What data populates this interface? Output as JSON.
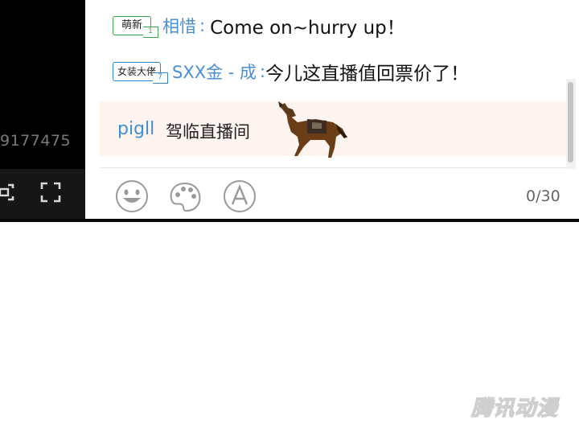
{
  "stream_player": {
    "viewer_count": "9177475",
    "controls": [
      {
        "icon": "picture-in-picture-icon"
      },
      {
        "icon": "fullscreen-icon"
      }
    ]
  },
  "chat": {
    "messages": [
      {
        "badge": "萌新",
        "badge_level": "1",
        "user": "相惜",
        "separator": ":",
        "text": "Come on~hurry up！"
      },
      {
        "badge": "女装大佬",
        "badge_level": "7",
        "user": "SXX金 - 成",
        "separator": ":",
        "text": "今儿这直播值回票价了！"
      }
    ],
    "welcome": {
      "user": "pigll",
      "text": "驾临直播间",
      "mount_icon": "horse-mount-icon"
    },
    "input": {
      "tools": [
        {
          "icon": "emoji-smile-icon"
        },
        {
          "icon": "palette-icon"
        },
        {
          "icon": "font-style-icon"
        }
      ],
      "char_count": "0/30"
    }
  },
  "watermark": {
    "text": "腾讯动漫"
  }
}
